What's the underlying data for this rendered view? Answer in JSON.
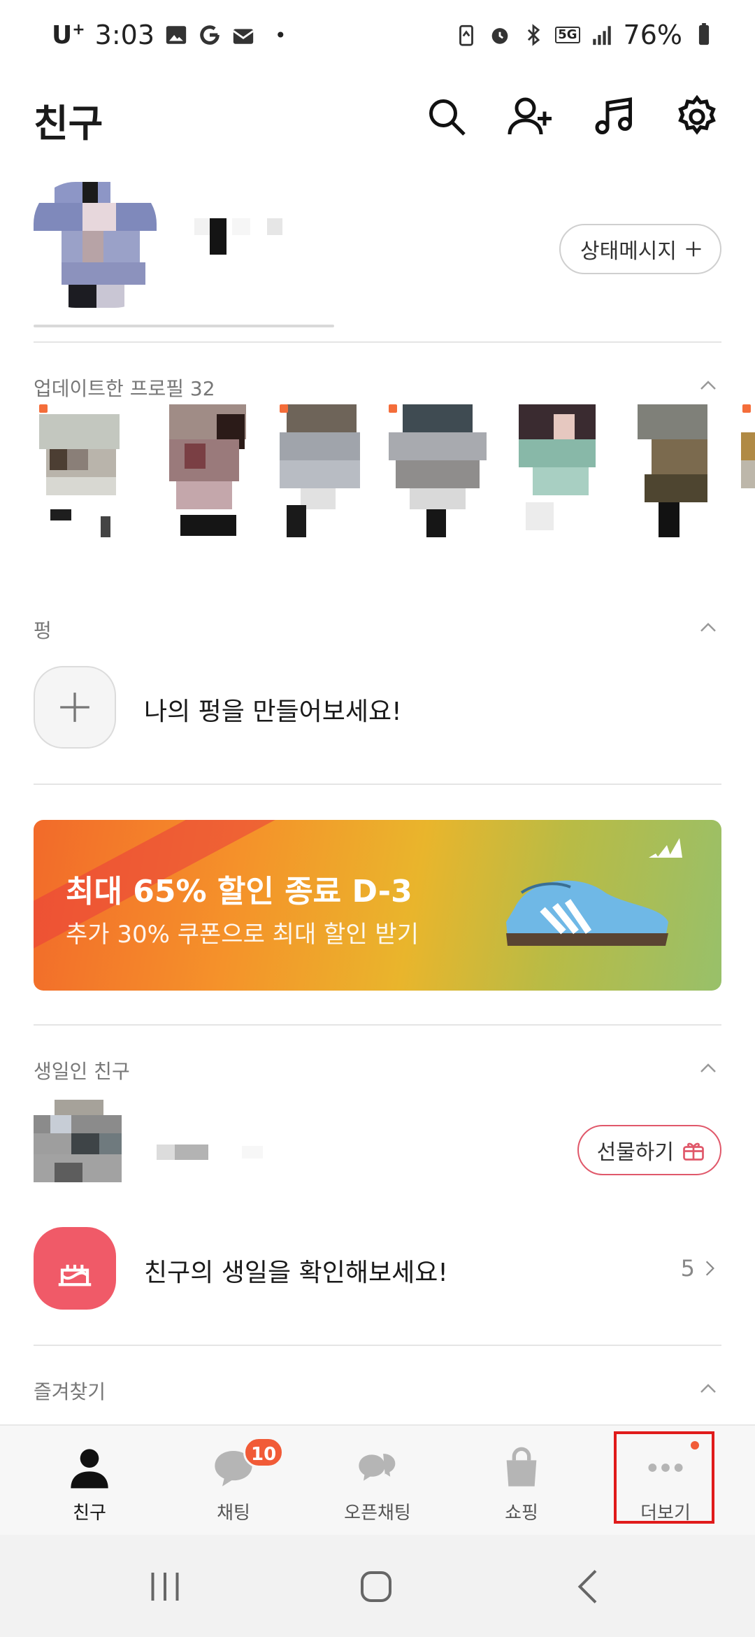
{
  "status_bar": {
    "carrier": "U",
    "carrier_sup": "+",
    "time": "3:03",
    "dot": "•",
    "network": "5G",
    "battery": "76%"
  },
  "header": {
    "title": "친구",
    "icons": [
      "search-icon",
      "add-friend-icon",
      "music-icon",
      "settings-icon"
    ]
  },
  "my_profile": {
    "status_message_button": "상태메시지"
  },
  "updated_profiles": {
    "title": "업데이트한 프로필 32"
  },
  "pyeong": {
    "title": "펑",
    "prompt": "나의 펑을 만들어보세요!"
  },
  "banner": {
    "title": "최대 65% 할인 종료 D-3",
    "subtitle": "추가 30% 쿠폰으로 최대 할인 받기"
  },
  "birthday": {
    "title": "생일인 친구",
    "gift_button": "선물하기",
    "check_prompt": "친구의 생일을 확인해보세요!",
    "count": "5"
  },
  "favorites": {
    "title": "즐겨찾기"
  },
  "bottom_nav": {
    "items": [
      {
        "label": "친구",
        "icon": "person-icon",
        "active": true
      },
      {
        "label": "채팅",
        "icon": "chat-bubble-icon",
        "badge": "10"
      },
      {
        "label": "오픈채팅",
        "icon": "open-chat-icon"
      },
      {
        "label": "쇼핑",
        "icon": "shopping-bag-icon"
      },
      {
        "label": "더보기",
        "icon": "more-dots-icon"
      }
    ]
  },
  "colors": {
    "accent": "#f15b37",
    "gift_border": "#e0586a",
    "cake_tile": "#f05a68",
    "highlight_box": "#e01b1b"
  }
}
